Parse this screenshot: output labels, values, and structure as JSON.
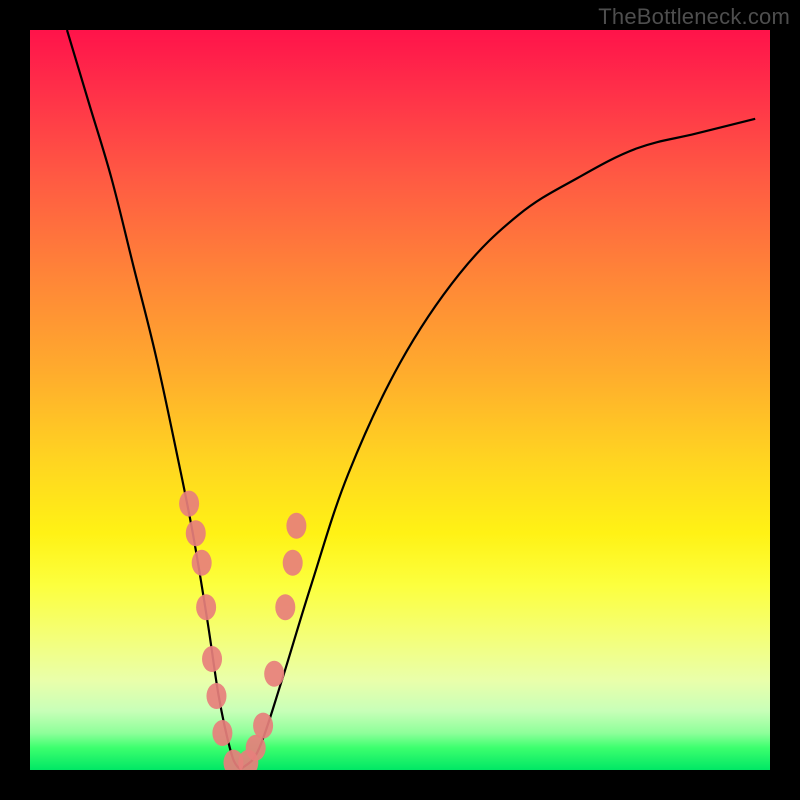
{
  "watermark": "TheBottleneck.com",
  "chart_data": {
    "type": "line",
    "title": "",
    "xlabel": "",
    "ylabel": "",
    "xlim": [
      0,
      100
    ],
    "ylim": [
      0,
      100
    ],
    "series": [
      {
        "name": "bottleneck-curve",
        "x": [
          5,
          8,
          11,
          14,
          17,
          20,
          22,
          24,
          25.5,
          27,
          28,
          29,
          31,
          34,
          38,
          43,
          50,
          58,
          66,
          74,
          82,
          90,
          98
        ],
        "y": [
          100,
          90,
          80,
          68,
          56,
          42,
          32,
          20,
          10,
          3,
          0.5,
          0.5,
          3,
          12,
          25,
          40,
          55,
          67,
          75,
          80,
          84,
          86,
          88
        ]
      }
    ],
    "markers": {
      "name": "highlight-dots",
      "x": [
        21.5,
        22.4,
        23.2,
        23.8,
        24.6,
        25.2,
        26.0,
        27.5,
        29.5,
        30.5,
        31.5,
        33.0,
        34.5,
        35.5,
        36.0
      ],
      "y": [
        36,
        32,
        28,
        22,
        15,
        10,
        5,
        1,
        1,
        3,
        6,
        13,
        22,
        28,
        33
      ]
    },
    "gradient_stops": [
      {
        "pos": 0.0,
        "color": "#ff134a"
      },
      {
        "pos": 0.33,
        "color": "#ff8438"
      },
      {
        "pos": 0.68,
        "color": "#fff215"
      },
      {
        "pos": 0.95,
        "color": "#8eff9a"
      },
      {
        "pos": 1.0,
        "color": "#00e765"
      }
    ]
  }
}
